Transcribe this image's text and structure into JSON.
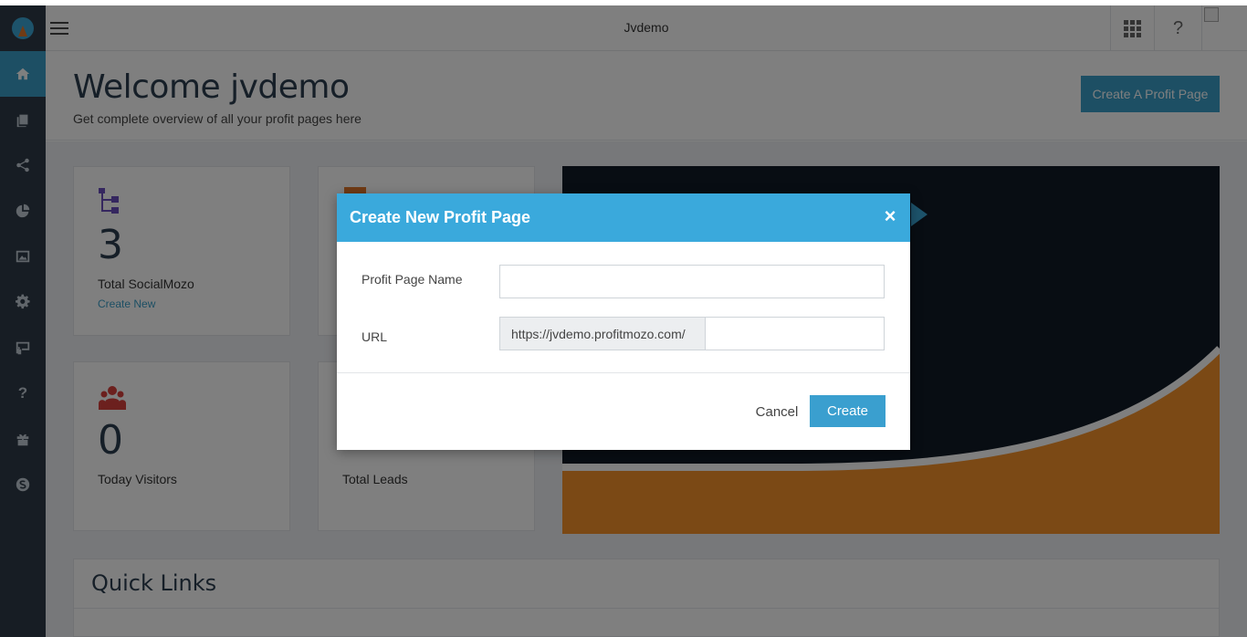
{
  "app": {
    "title": "Jvdemo"
  },
  "sidebar": {
    "items": [
      {
        "name": "home",
        "icon": "home-icon"
      },
      {
        "name": "pages",
        "icon": "copy-icon"
      },
      {
        "name": "share",
        "icon": "share-icon"
      },
      {
        "name": "reports",
        "icon": "pie-chart-icon"
      },
      {
        "name": "images",
        "icon": "image-icon"
      },
      {
        "name": "settings",
        "icon": "gear-icon"
      },
      {
        "name": "team",
        "icon": "presentation-icon"
      },
      {
        "name": "help",
        "icon": "question-icon"
      },
      {
        "name": "gifts",
        "icon": "gift-icon"
      },
      {
        "name": "skype",
        "icon": "skype-icon"
      }
    ]
  },
  "header": {
    "help_label": "?"
  },
  "welcome": {
    "title": "Welcome jvdemo",
    "subtitle": "Get complete overview of all your profit pages here",
    "create_button": "Create A Profit Page"
  },
  "stats": {
    "socialmozo_count": "3",
    "socialmozo_label": "Total SocialMozo",
    "socialmozo_link": "Create New",
    "visitors_count": "0",
    "visitors_label": "Today Visitors",
    "leads_label": "Total Leads"
  },
  "quick_links": {
    "title": "Quick Links"
  },
  "modal": {
    "title": "Create New Profit Page",
    "close": "×",
    "name_label": "Profit Page Name",
    "name_value": "",
    "url_label": "URL",
    "url_prefix": "https://jvdemo.profitmozo.com/",
    "url_value": "",
    "cancel": "Cancel",
    "create": "Create"
  },
  "colors": {
    "accent": "#3aa9dc",
    "sidebar": "#2e3b48",
    "banner_orange": "#f7922a",
    "banner_dark": "#101a26"
  }
}
